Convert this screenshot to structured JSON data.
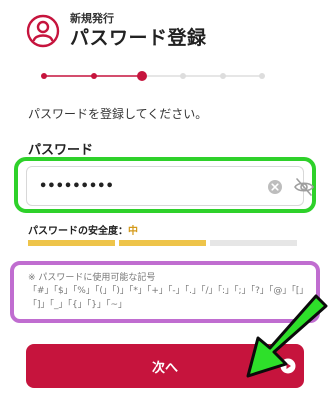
{
  "header": {
    "subtitle": "新規発行",
    "title": "パスワード登録",
    "icon": "user-circle-icon"
  },
  "steps": {
    "total": 6,
    "current": 3
  },
  "instruction": "パスワードを登録してください。",
  "password": {
    "label": "パスワード",
    "masked_value": "•••••••••"
  },
  "strength": {
    "label": "パスワードの安全度：",
    "level": "中",
    "filled_bars": 2,
    "total_bars": 3
  },
  "note": {
    "title": "※ パスワードに使用可能な記号",
    "symbols": "「#」「$」「%」「(」「)」「*」「+」「-」「.」「/」「:」「;」「?」「@」「[」「]」「_」「{」「}」「~」"
  },
  "next_button": {
    "label": "次へ"
  },
  "colors": {
    "brand": "#c6143d",
    "highlight_green": "#2ed12a",
    "highlight_purple": "#c06dd0",
    "strength_on": "#eec44a"
  }
}
